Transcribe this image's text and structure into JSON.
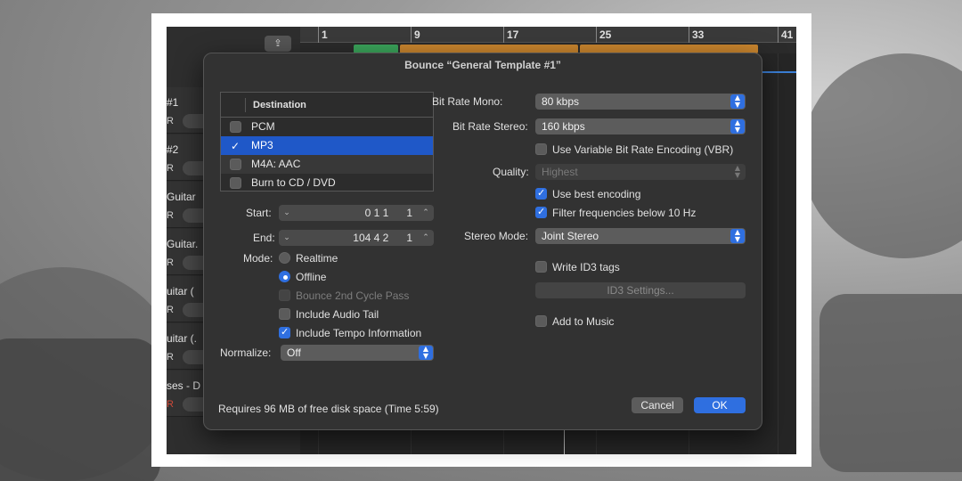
{
  "dialog": {
    "title": "Bounce “General Template #1”",
    "destination_header": "Destination",
    "destinations": [
      {
        "label": "PCM",
        "checked": false,
        "selected": false
      },
      {
        "label": "MP3",
        "checked": true,
        "selected": true
      },
      {
        "label": "M4A: AAC",
        "checked": false,
        "selected": false
      },
      {
        "label": "Burn to CD / DVD",
        "checked": false,
        "selected": false
      }
    ],
    "start_label": "Start:",
    "start_value": "0 1 1      1",
    "end_label": "End:",
    "end_value": "104 4 2      1",
    "mode_label": "Mode:",
    "mode_realtime": "Realtime",
    "mode_offline": "Offline",
    "bounce_2nd_cycle": "Bounce 2nd Cycle Pass",
    "include_audio_tail": "Include Audio Tail",
    "include_tempo": "Include Tempo Information",
    "normalize_label": "Normalize:",
    "normalize_value": "Off",
    "bit_rate_mono_label": "Bit Rate Mono:",
    "bit_rate_mono_value": "80 kbps",
    "bit_rate_stereo_label": "Bit Rate Stereo:",
    "bit_rate_stereo_value": "160 kbps",
    "vbr_label": "Use Variable Bit Rate Encoding (VBR)",
    "quality_label": "Quality:",
    "quality_value": "Highest",
    "best_encoding_label": "Use best encoding",
    "filter_label": "Filter frequencies below 10 Hz",
    "stereo_mode_label": "Stereo Mode:",
    "stereo_mode_value": "Joint Stereo",
    "write_id3_label": "Write ID3 tags",
    "id3_settings_label": "ID3 Settings...",
    "add_to_music_label": "Add to Music",
    "footer": "Requires 96 MB of free disk space  (Time 5:59)",
    "cancel_label": "Cancel",
    "ok_label": "OK"
  },
  "background_window": {
    "ruler_ticks": [
      "1",
      "9",
      "17",
      "25",
      "33",
      "41"
    ],
    "tracks": [
      "#1",
      "#2",
      "Guitar",
      "Guitar.",
      "uitar (",
      "uitar (.",
      "ses - D"
    ],
    "track_badge": "R"
  },
  "colors": {
    "accent": "#2f6fe0",
    "selection": "#1f58c8",
    "dialog_bg": "#323232"
  },
  "icons": {
    "checkbox": "checkmark",
    "popup": "up-down-chevron-icon",
    "stepper": "chevron-down-up-icon",
    "upload": "share-icon"
  }
}
